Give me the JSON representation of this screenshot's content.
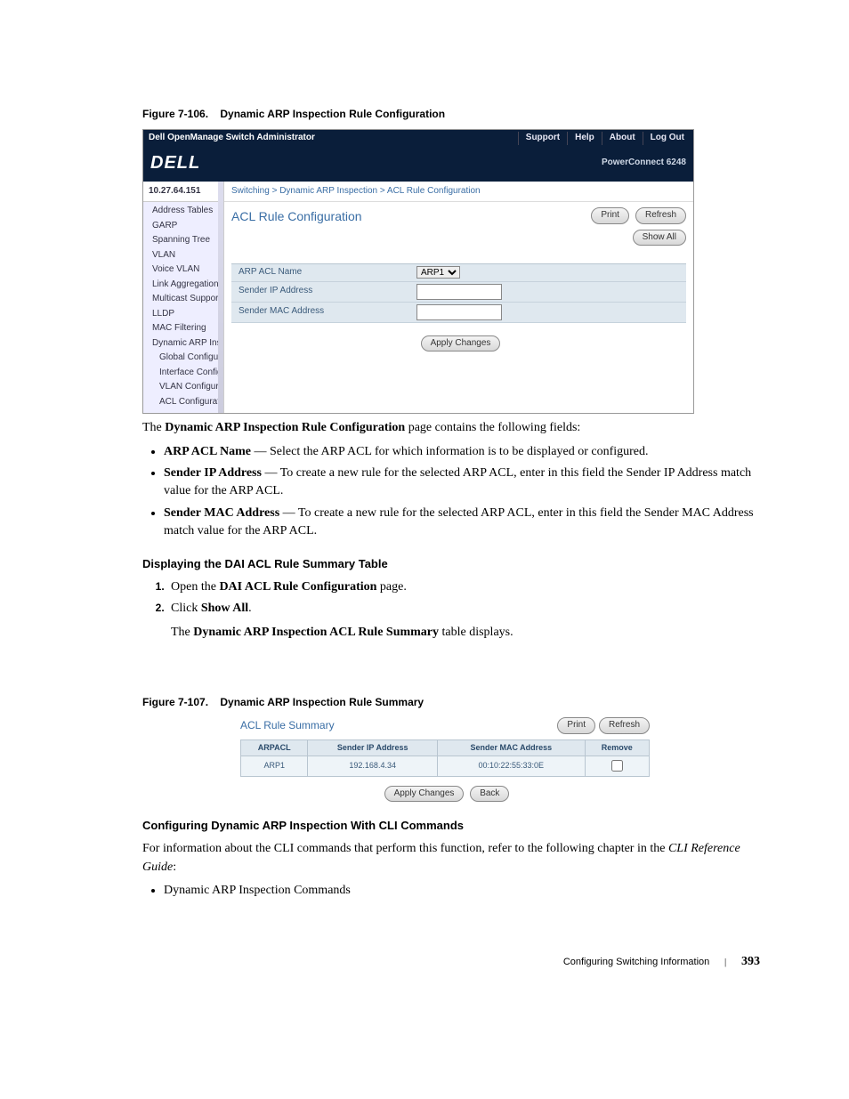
{
  "figure106": {
    "caption_prefix": "Figure 7-106.",
    "caption_title": "Dynamic ARP Inspection Rule Configuration",
    "topbar_title": "Dell OpenManage Switch Administrator",
    "topbar_links": [
      "Support",
      "Help",
      "About",
      "Log Out"
    ],
    "brand": "DELL",
    "model": "PowerConnect 6248",
    "ip": "10.27.64.151",
    "tree": [
      "Address Tables",
      "GARP",
      "Spanning Tree",
      "VLAN",
      "Voice VLAN",
      "Link Aggregation",
      "Multicast Support",
      "LLDP",
      "MAC Filtering",
      "Dynamic ARP Inspe"
    ],
    "tree_sub": [
      "Global Configurat",
      "Interface Configu",
      "VLAN Configurati",
      "ACL Configuratio"
    ],
    "breadcrumb": "Switching > Dynamic ARP Inspection > ACL Rule Configuration",
    "panel_title": "ACL Rule Configuration",
    "btn_print": "Print",
    "btn_refresh": "Refresh",
    "btn_showall": "Show All",
    "form": {
      "label1": "ARP ACL Name",
      "value1": "ARP1",
      "label2": "Sender IP Address",
      "label3": "Sender MAC Address"
    },
    "btn_apply": "Apply Changes"
  },
  "body": {
    "intro_pre": "The ",
    "intro_bold": "Dynamic ARP Inspection Rule Configuration",
    "intro_post": " page contains the following fields:",
    "bullet1_bold": "ARP ACL Name",
    "bullet1_text": " — Select the ARP ACL for which information is to be displayed or configured.",
    "bullet2_bold": "Sender IP Address",
    "bullet2_text": " — To create a new rule for the selected ARP ACL, enter in this field the Sender IP Address match value for the ARP ACL.",
    "bullet3_bold": "Sender MAC Address",
    "bullet3_text": " — To create a new rule for the selected ARP ACL, enter in this field the Sender MAC Address match value for the ARP ACL."
  },
  "subhead1": "Displaying the DAI ACL Rule Summary Table",
  "step1_pre": "Open the ",
  "step1_bold": "DAI ACL Rule Configuration",
  "step1_post": " page.",
  "step2_pre": "Click ",
  "step2_bold": "Show All",
  "step2_post": ".",
  "step_result_pre": "The ",
  "step_result_bold": "Dynamic ARP Inspection ACL Rule Summary",
  "step_result_post": " table displays.",
  "figure107": {
    "caption_prefix": "Figure 7-107.",
    "caption_title": "Dynamic ARP Inspection Rule Summary",
    "panel_title": "ACL Rule Summary",
    "btn_print": "Print",
    "btn_refresh": "Refresh",
    "headers": [
      "ARPACL",
      "Sender IP Address",
      "Sender MAC Address",
      "Remove"
    ],
    "row": [
      "ARP1",
      "192.168.4.34",
      "00:10:22:55:33:0E",
      ""
    ],
    "btn_apply": "Apply Changes",
    "btn_back": "Back"
  },
  "subhead2": "Configuring Dynamic ARP Inspection With CLI Commands",
  "cli_text_pre": "For information about the CLI commands that perform this function, refer to the following chapter in the ",
  "cli_text_italic": "CLI Reference Guide",
  "cli_text_post": ":",
  "cli_bullet": "Dynamic ARP Inspection Commands",
  "footer_title": "Configuring Switching Information",
  "footer_page": "393"
}
